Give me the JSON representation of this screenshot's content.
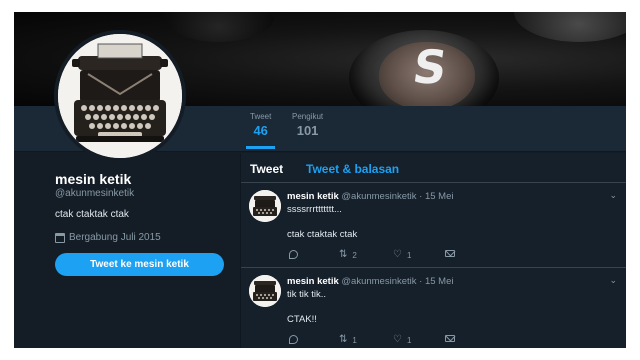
{
  "profile": {
    "name": "mesin ketik",
    "handle": "@akunmesinketik",
    "bio": "ctak ctaktak ctak",
    "joined": "Bergabung Juli 2015",
    "tweet_button": "Tweet ke mesin ketik",
    "banner_key_letter": "S"
  },
  "nav": {
    "tweets": {
      "label": "Tweet",
      "value": "46"
    },
    "followers": {
      "label": "Pengikut",
      "value": "101"
    }
  },
  "timeline": {
    "tabs": [
      "Tweet",
      "Tweet & balasan"
    ],
    "tweets": [
      {
        "name": "mesin ketik",
        "meta": "@akunmesinketik · 15 Mei",
        "line1": "ssssrrrttttttt...",
        "line2": "ctak ctaktak ctak",
        "retweets": "2",
        "likes": "1"
      },
      {
        "name": "mesin ketik",
        "meta": "@akunmesinketik · 15 Mei",
        "line1": "tik tik tik..",
        "line2": "CTAK!!",
        "retweets": "1",
        "likes": "1"
      }
    ]
  },
  "icons": {
    "caret": "chevron-down-icon",
    "reply": "reply-icon",
    "retweet": "retweet-icon",
    "like": "heart-icon",
    "message": "mail-icon",
    "calendar": "calendar-icon"
  },
  "colors": {
    "accent": "#1da1f2",
    "background": "#141d26",
    "panel": "#1b2836",
    "text_secondary": "#8899a6"
  }
}
